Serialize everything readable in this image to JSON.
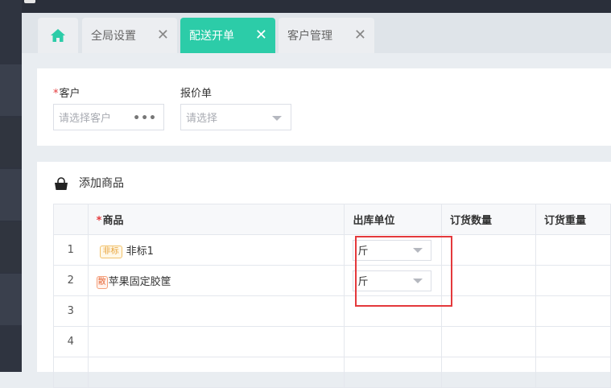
{
  "tabs": [
    {
      "label": "",
      "icon": "home-icon"
    },
    {
      "label": "全局设置",
      "close": "✕"
    },
    {
      "label": "配送开单",
      "close": "✕",
      "active": true
    },
    {
      "label": "客户管理",
      "close": "✕"
    }
  ],
  "form": {
    "customer": {
      "required_mark": "*",
      "label": "客户",
      "placeholder": "请选择客户",
      "more": "•••"
    },
    "price_list": {
      "label": "报价单",
      "placeholder": "请选择"
    }
  },
  "products": {
    "title": "添加商品",
    "columns": {
      "index": "",
      "product": "商品",
      "product_required": "*",
      "unit": "出库单位",
      "qty": "订货数量",
      "weight": "订货重量"
    },
    "rows": [
      {
        "index": "1",
        "badge": "非标",
        "name": "非标1",
        "unit": "斤"
      },
      {
        "index": "2",
        "badge": "散",
        "name": "苹果固定胶筐",
        "unit": "斤"
      },
      {
        "index": "3",
        "badge": "",
        "name": "",
        "unit": ""
      },
      {
        "index": "4",
        "badge": "",
        "name": "",
        "unit": ""
      },
      {
        "index": "",
        "badge": "",
        "name": "",
        "unit": ""
      }
    ]
  },
  "colors": {
    "accent": "#2ccca8",
    "highlight": "#e4393c",
    "sidebar": "#2f3440"
  }
}
